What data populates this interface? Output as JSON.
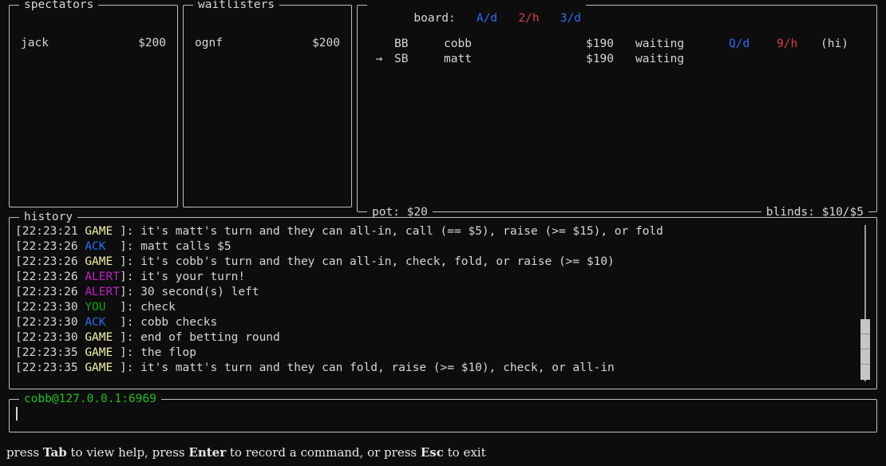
{
  "colors": {
    "background": "#0d0d0d",
    "border": "#bfbfbf",
    "text": "#d6d6d6",
    "card_blue": "#2a6ef5",
    "card_red": "#e03c4a",
    "tag_game": "#f2f2a6",
    "tag_ack": "#2a6ef5",
    "tag_alert": "#c21fc2",
    "tag_you": "#17a117",
    "prompt_green": "#1fbf1f"
  },
  "spectators": {
    "title": "spectators",
    "rows": [
      {
        "name": "jack",
        "amount": "$200"
      }
    ]
  },
  "waitlisters": {
    "title": "waitlisters",
    "rows": [
      {
        "name": "ognf",
        "amount": "$200"
      }
    ]
  },
  "board": {
    "label": "board:",
    "cards": [
      {
        "text": "A/d",
        "color": "blue"
      },
      {
        "text": "2/h",
        "color": "red"
      },
      {
        "text": "3/d",
        "color": "blue"
      }
    ],
    "players": [
      {
        "arrow": "",
        "position": "BB",
        "name": "cobb",
        "stack": "$190",
        "status": "waiting",
        "card1": {
          "text": "Q/d",
          "color": "blue"
        },
        "card2": {
          "text": "9/h",
          "color": "red"
        },
        "tag": "(hi)"
      },
      {
        "arrow": "→",
        "position": "SB",
        "name": "matt",
        "stack": "$190",
        "status": "waiting",
        "card1": {
          "text": "",
          "color": "plain"
        },
        "card2": {
          "text": "",
          "color": "plain"
        },
        "tag": ""
      }
    ],
    "pot": "pot: $20",
    "blinds": "blinds: $10/$5"
  },
  "history": {
    "title": "history",
    "lines": [
      {
        "time": "[22:23:21 ",
        "tag": "GAME ",
        "tag_type": "GAME",
        "message": "]: it's matt's turn and they can all-in, call (== $5), raise (>= $15), or fold"
      },
      {
        "time": "[22:23:26 ",
        "tag": "ACK  ",
        "tag_type": "ACK",
        "message": "]: matt calls $5"
      },
      {
        "time": "[22:23:26 ",
        "tag": "GAME ",
        "tag_type": "GAME",
        "message": "]: it's cobb's turn and they can all-in, check, fold, or raise (>= $10)"
      },
      {
        "time": "[22:23:26 ",
        "tag": "ALERT",
        "tag_type": "ALERT",
        "message": "]: it's your turn!"
      },
      {
        "time": "[22:23:26 ",
        "tag": "ALERT",
        "tag_type": "ALERT",
        "message": "]: 30 second(s) left"
      },
      {
        "time": "[22:23:30 ",
        "tag": "YOU  ",
        "tag_type": "YOU",
        "message": "]: check"
      },
      {
        "time": "[22:23:30 ",
        "tag": "ACK  ",
        "tag_type": "ACK",
        "message": "]: cobb checks"
      },
      {
        "time": "[22:23:30 ",
        "tag": "GAME ",
        "tag_type": "GAME",
        "message": "]: end of betting round"
      },
      {
        "time": "[22:23:35 ",
        "tag": "GAME ",
        "tag_type": "GAME",
        "message": "]: the flop"
      },
      {
        "time": "[22:23:35 ",
        "tag": "GAME ",
        "tag_type": "GAME",
        "message": "]: it's matt's turn and they can fold, raise (>= $10), check, or all-in"
      }
    ]
  },
  "prompt": {
    "title": "cobb@127.0.0.1:6969",
    "value": ""
  },
  "status_bar": {
    "segments": [
      {
        "text": "press ",
        "bold": false
      },
      {
        "text": "Tab",
        "bold": true
      },
      {
        "text": " to view help, press ",
        "bold": false
      },
      {
        "text": "Enter",
        "bold": true
      },
      {
        "text": " to record a command, or press ",
        "bold": false
      },
      {
        "text": "Esc",
        "bold": true
      },
      {
        "text": " to exit",
        "bold": false
      }
    ]
  }
}
